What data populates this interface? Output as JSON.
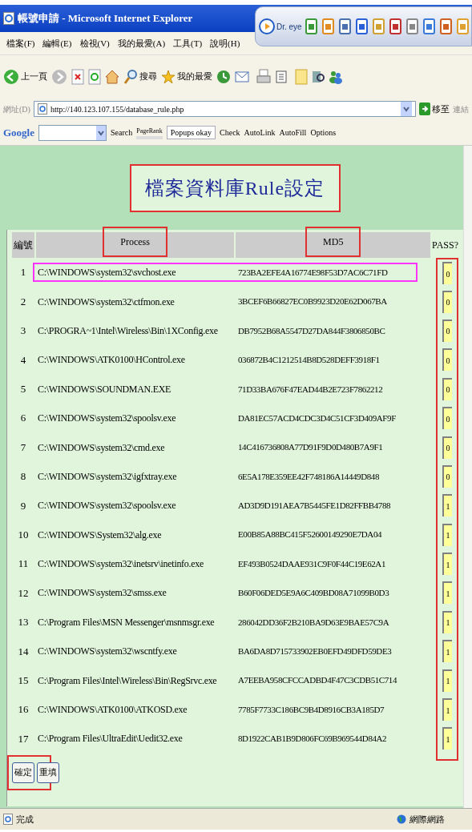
{
  "window": {
    "title": "帳號申請 - Microsoft Internet Explorer"
  },
  "drEye": {
    "label": "Dr. eye"
  },
  "menu": [
    "檔案(F)",
    "編輯(E)",
    "檢視(V)",
    "我的最愛(A)",
    "工具(T)",
    "說明(H)"
  ],
  "toolbar": {
    "back": "上一頁",
    "search": "搜尋",
    "favorites": "我的最愛"
  },
  "address": {
    "label": "網址(D)",
    "url": "http://140.123.107.155/database_rule.php",
    "go": "移至",
    "links": "連結"
  },
  "google": {
    "logo": "Google",
    "search": "Search",
    "pagerank": "PageRank",
    "popups": "Popups okay",
    "check": "Check",
    "autolink": "AutoLink",
    "autofill": "AutoFill",
    "options": "Options"
  },
  "page": {
    "title": "檔案資料庫Rule設定",
    "columns": [
      "編號",
      "Process",
      "MD5",
      "PASS?"
    ],
    "rows": [
      {
        "no": "1",
        "process": "C:\\WINDOWS\\system32\\svchost.exe",
        "md5": "723BA2EFE4A16774E98F53D7AC6C71FD",
        "pass": "0",
        "highlighted": true
      },
      {
        "no": "2",
        "process": "C:\\WINDOWS\\system32\\ctfmon.exe",
        "md5": "3BCEF6B66827EC0B9923D20E62D067BA",
        "pass": "0",
        "highlighted": false
      },
      {
        "no": "3",
        "process": "C:\\PROGRA~1\\Intel\\Wireless\\Bin\\1XConfig.exe",
        "md5": "DB7952B68A5547D27DA844F3806850BC",
        "pass": "0",
        "highlighted": false
      },
      {
        "no": "4",
        "process": "C:\\WINDOWS\\ATK0100\\HControl.exe",
        "md5": "036872B4C1212514B8D528DEFF3918F1",
        "pass": "0",
        "highlighted": false
      },
      {
        "no": "5",
        "process": "C:\\WINDOWS\\SOUNDMAN.EXE",
        "md5": "71D33BA676F47EAD44B2E723F7862212",
        "pass": "0",
        "highlighted": false
      },
      {
        "no": "6",
        "process": "C:\\WINDOWS\\system32\\spoolsv.exe",
        "md5": "DA81EC57ACD4CDC3D4C51CF3D409AF9F",
        "pass": "0",
        "highlighted": false
      },
      {
        "no": "7",
        "process": "C:\\WINDOWS\\system32\\cmd.exe",
        "md5": "14C416736808A77D91F9D0D480B7A9F1",
        "pass": "0",
        "highlighted": false
      },
      {
        "no": "8",
        "process": "C:\\WINDOWS\\system32\\igfxtray.exe",
        "md5": "6E5A178E359EE42F748186A14449D848",
        "pass": "0",
        "highlighted": false
      },
      {
        "no": "9",
        "process": "C:\\WINDOWS\\system32\\spoolsv.exe",
        "md5": "AD3D9D191AEA7B5445FE1D82FFBB4788",
        "pass": "1",
        "highlighted": false
      },
      {
        "no": "10",
        "process": "C:\\WINDOWS\\System32\\alg.exe",
        "md5": "E00B85A88BC415F52600149290E7DA04",
        "pass": "1",
        "highlighted": false
      },
      {
        "no": "11",
        "process": "C:\\WINDOWS\\system32\\inetsrv\\inetinfo.exe",
        "md5": "EF493B0524DAAE931C9F0F44C19E62A1",
        "pass": "1",
        "highlighted": false
      },
      {
        "no": "12",
        "process": "C:\\WINDOWS\\system32\\smss.exe",
        "md5": "B60F06DED5E9A6C409BD08A71099B0D3",
        "pass": "1",
        "highlighted": false
      },
      {
        "no": "13",
        "process": "C:\\Program Files\\MSN Messenger\\msnmsgr.exe",
        "md5": "286042DD36F2B210BA9D63E9BAE57C9A",
        "pass": "1",
        "highlighted": false
      },
      {
        "no": "14",
        "process": "C:\\WINDOWS\\system32\\wscntfy.exe",
        "md5": "BA6DA8D715733902EB0EFD49DFD59DE3",
        "pass": "1",
        "highlighted": false
      },
      {
        "no": "15",
        "process": "C:\\Program Files\\Intel\\Wireless\\Bin\\RegSrvc.exe",
        "md5": "A7EEBA958CFCCADBD4F47C3CDB51C714",
        "pass": "1",
        "highlighted": false
      },
      {
        "no": "16",
        "process": "C:\\WINDOWS\\ATK0100\\ATKOSD.exe",
        "md5": "7785F7733C186BC9B4D8916CB3A185D7",
        "pass": "1",
        "highlighted": false
      },
      {
        "no": "17",
        "process": "C:\\Program Files\\UltraEdit\\Uedit32.exe",
        "md5": "8D1922CAB1B9D806FC69B969544D84A2",
        "pass": "1",
        "highlighted": false
      }
    ],
    "buttons": [
      "確定",
      "重填"
    ]
  },
  "status": {
    "text": "完成",
    "zone": "網際網路"
  }
}
